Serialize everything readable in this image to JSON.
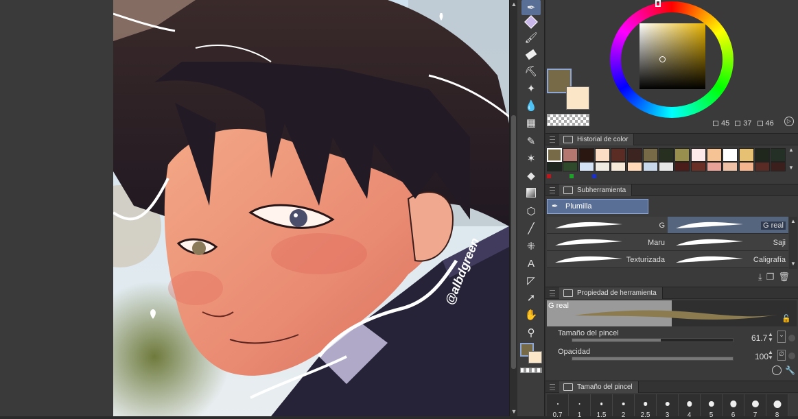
{
  "canvas": {
    "watermark": "@albdgreen"
  },
  "toolbar": {
    "tools": [
      "pen-icon",
      "eraser-marker-icon",
      "marker-icon",
      "eraser-icon",
      "stamp-icon",
      "sparkle-icon",
      "blend-icon",
      "mesh-icon",
      "correct-line-icon",
      "auto-select-icon",
      "fill-icon",
      "gradient-icon",
      "3d-object-icon",
      "line-icon",
      "pattern-icon",
      "text-icon",
      "ruler-icon",
      "operation-icon",
      "hand-icon",
      "eyedropper-icon"
    ]
  },
  "colors": {
    "main": "#766a47",
    "sub": "#fbe6c8",
    "accent": "#5a6f95"
  },
  "color_wheel": {
    "h": "45",
    "s": "37",
    "v": "46"
  },
  "color_history": {
    "title": "Historial de color",
    "row1": [
      "#766a47",
      "#b57870",
      "#2a1712",
      "#fbdcc5",
      "#5a2c24",
      "#3c2521",
      "#766a47",
      "#273020",
      "#988e4e",
      "#fce9e8",
      "#f6c394",
      "#ffffff",
      "#e6c174",
      "#1f261c",
      "#243025"
    ],
    "row2": [
      "#1e2620",
      "#2f4a2a",
      "#d4e2f5",
      "#f0ebe2",
      "#f7e9d8",
      "#ffd9b8",
      "#c8d8ea",
      "#e6e6e6",
      "#4a1d1a",
      "#6a3028",
      "#e8a297",
      "#f0c0a6",
      "#f4b48e",
      "#5a2a24",
      "#3b1f1c"
    ],
    "marks": [
      "#c0151a",
      "#1ea02a",
      "#1b2fd0"
    ]
  },
  "subtool": {
    "title": "Subherramienta",
    "group": "Plumilla",
    "brushes": [
      {
        "label": "G",
        "selected": false
      },
      {
        "label": "G real",
        "selected": true
      },
      {
        "label": "Maru",
        "selected": false
      },
      {
        "label": "Saji",
        "selected": false
      },
      {
        "label": "Texturizada",
        "selected": false
      },
      {
        "label": "Caligrafía",
        "selected": false
      }
    ]
  },
  "tool_property": {
    "title": "Propiedad de herramienta",
    "preview_label": "G real",
    "brush_size_label": "Tamaño del pincel",
    "brush_size_value": "61.7",
    "brush_size_fraction": 0.55,
    "opacity_label": "Opacidad",
    "opacity_value": "100",
    "opacity_fraction": 1.0
  },
  "brush_size_panel": {
    "title": "Tamaño del pincel",
    "sizes": [
      "0.7",
      "1",
      "1.5",
      "2",
      "2.5",
      "3",
      "4",
      "5",
      "6",
      "7",
      "8"
    ]
  }
}
